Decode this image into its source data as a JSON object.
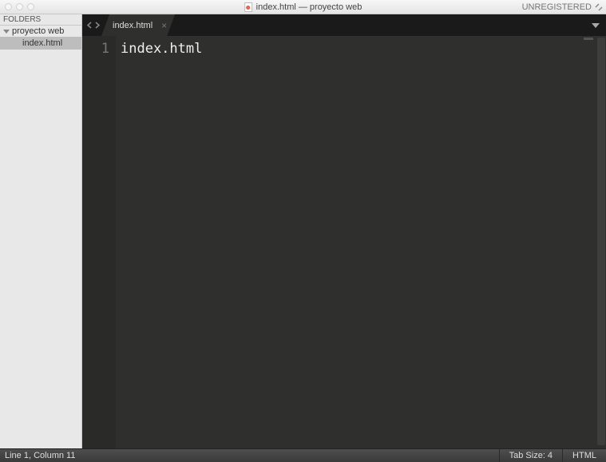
{
  "titlebar": {
    "title": "index.html — proyecto web",
    "unregistered": "UNREGISTERED"
  },
  "sidebar": {
    "header": "FOLDERS",
    "folder": {
      "name": "proyecto web"
    },
    "files": [
      {
        "name": "index.html"
      }
    ]
  },
  "tabs": [
    {
      "label": "index.html"
    }
  ],
  "editor": {
    "lines": [
      {
        "num": "1",
        "text": "index.html"
      }
    ]
  },
  "statusbar": {
    "position": "Line 1, Column 11",
    "tabsize": "Tab Size: 4",
    "syntax": "HTML"
  }
}
